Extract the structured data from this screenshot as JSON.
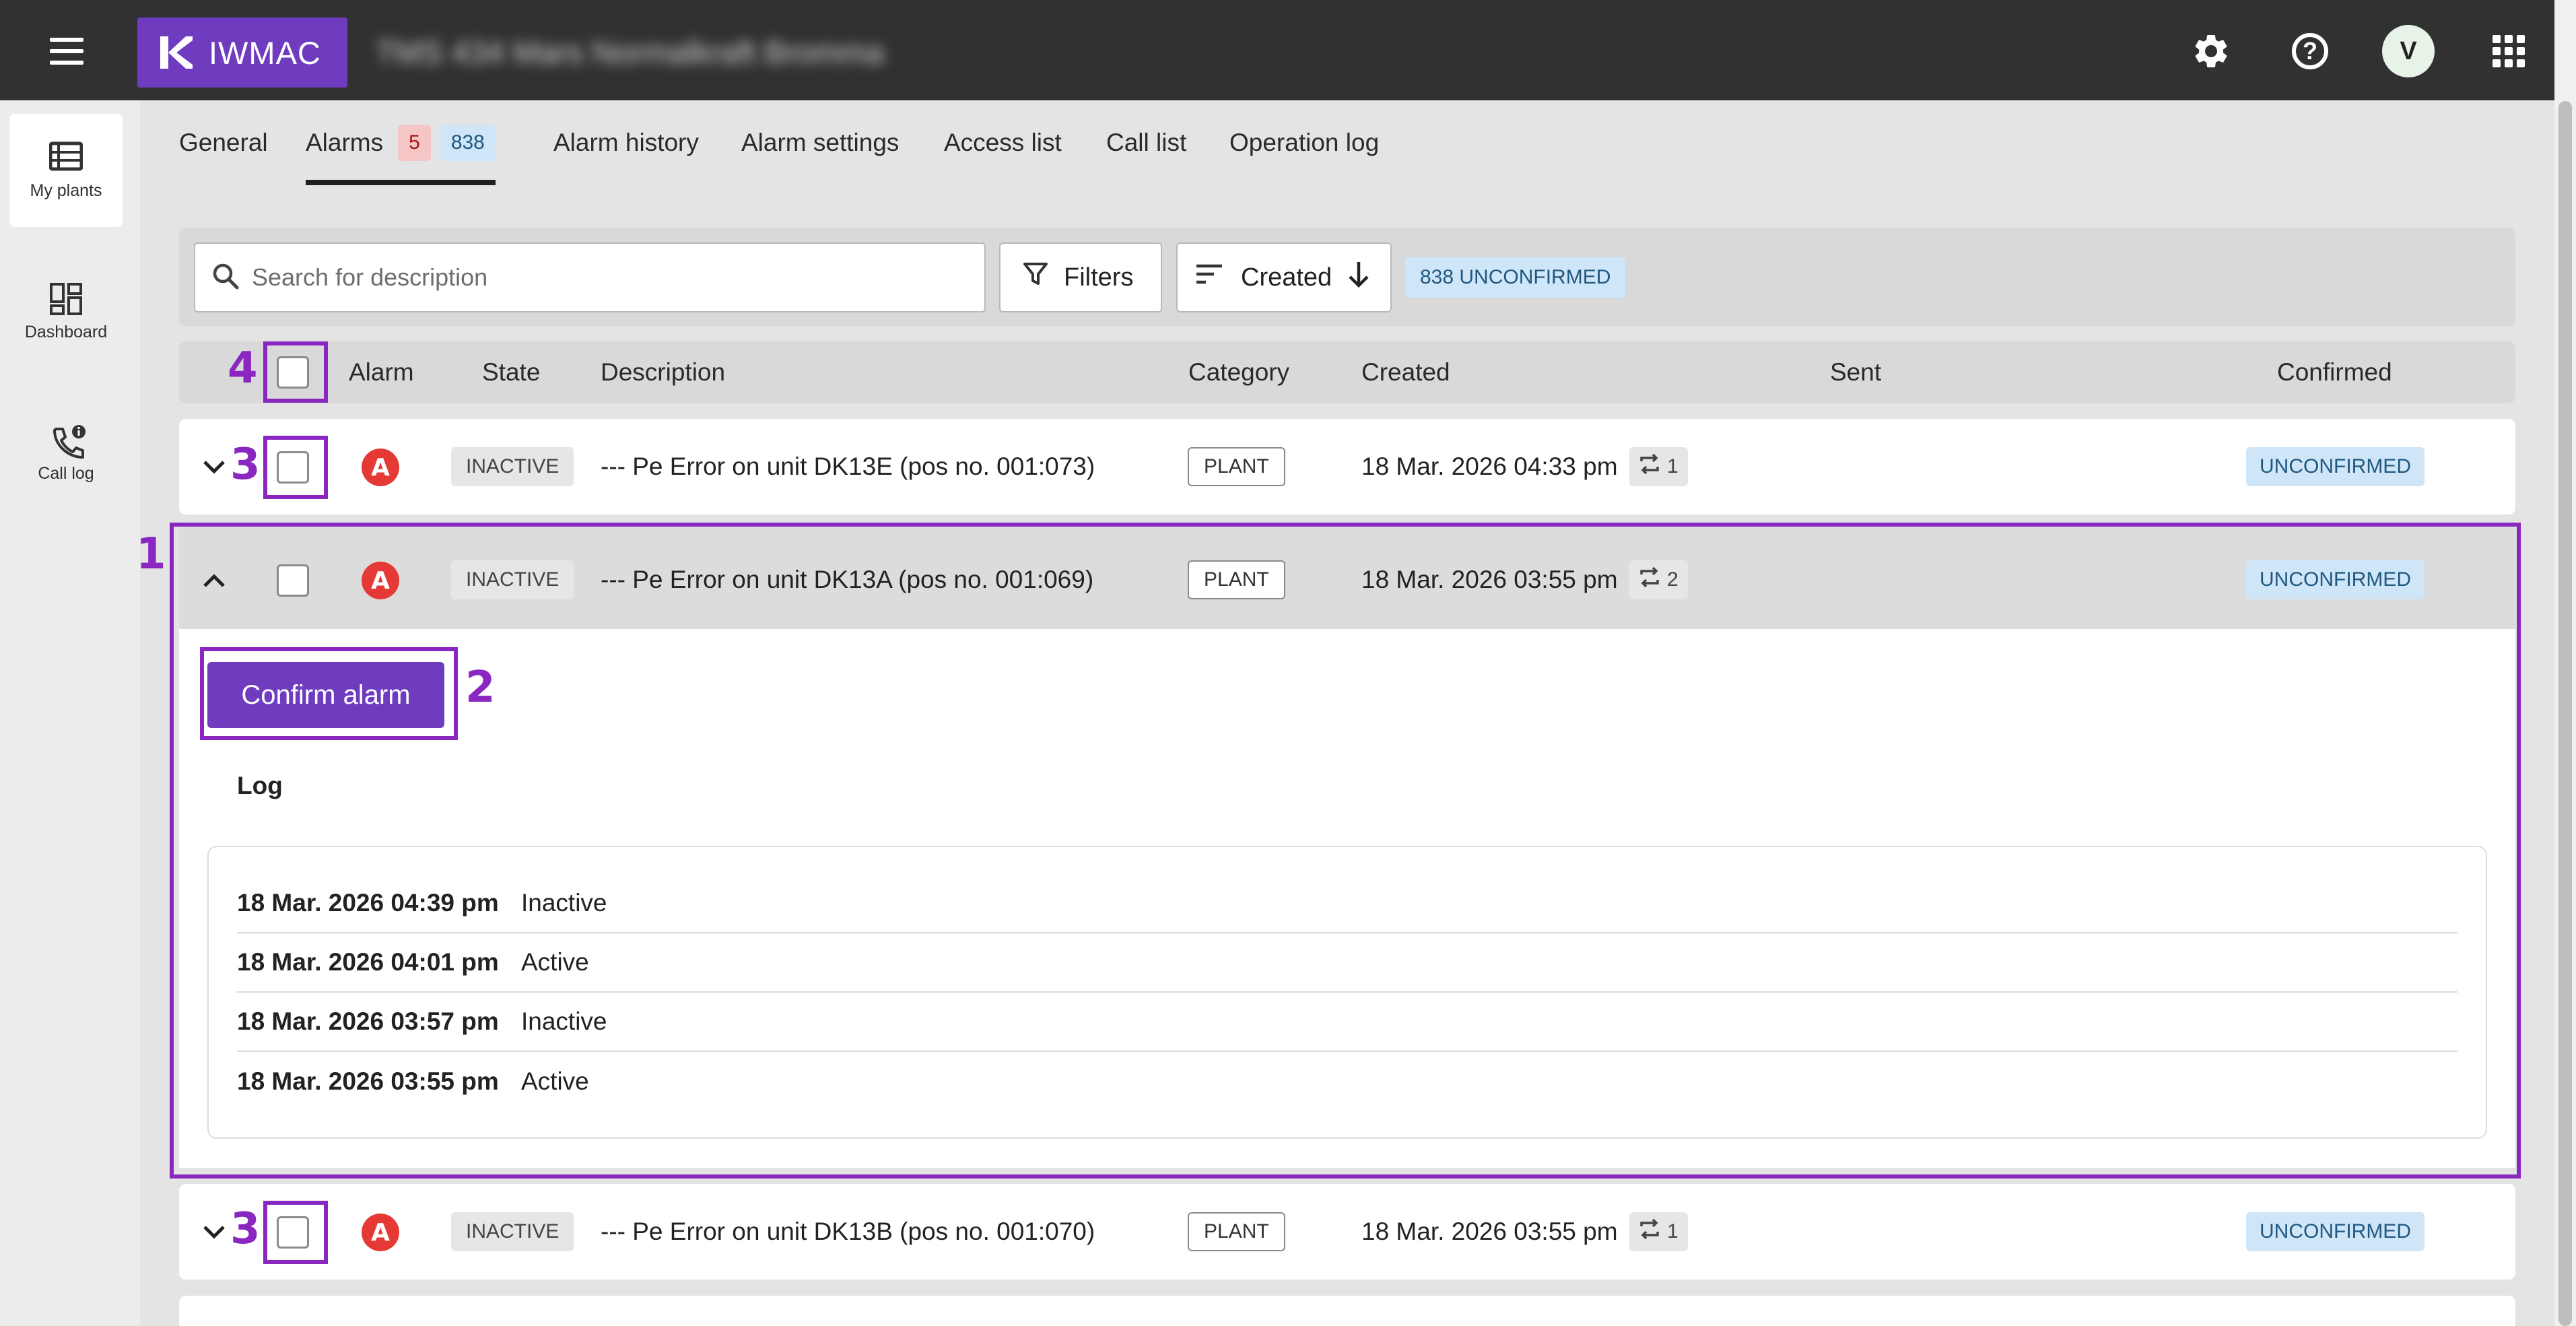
{
  "app": {
    "brand": "IWMAC",
    "plant_title": "TMS 434 Mars Normalkraft Bromma"
  },
  "topbar": {
    "icons": [
      "menu-icon",
      "settings-icon",
      "help-icon",
      "apps-grid-icon"
    ],
    "avatar_initial": "V"
  },
  "rail": {
    "items": [
      {
        "label": "My plants",
        "icon": "list-icon"
      },
      {
        "label": "Dashboard",
        "icon": "dashboard-icon"
      },
      {
        "label": "Call log",
        "icon": "phone-info-icon"
      }
    ]
  },
  "tabs": {
    "general": "General",
    "alarms": "Alarms",
    "alarms_active_count": "5",
    "alarms_unconfirmed_count": "838",
    "alarm_history": "Alarm history",
    "alarm_settings": "Alarm settings",
    "access_list": "Access list",
    "call_list": "Call list",
    "operation_log": "Operation log"
  },
  "toolbar": {
    "search_placeholder": "Search for description",
    "filters_label": "Filters",
    "sort_label": "Created",
    "unconfirmed_chip": "838 UNCONFIRMED"
  },
  "table": {
    "headers": {
      "alarm": "Alarm",
      "state": "State",
      "description": "Description",
      "category": "Category",
      "created": "Created",
      "sent": "Sent",
      "confirmed": "Confirmed"
    },
    "rows": [
      {
        "alarm": "A",
        "state": "INACTIVE",
        "description": "--- Pe Error on unit DK13E (pos no. 001:073)",
        "category": "PLANT",
        "created": "18 Mar. 2026 04:33 pm",
        "repeat": "1",
        "confirmed": "UNCONFIRMED"
      },
      {
        "alarm": "A",
        "state": "INACTIVE",
        "description": "--- Pe Error on unit DK13A (pos no. 001:069)",
        "category": "PLANT",
        "created": "18 Mar. 2026 03:55 pm",
        "repeat": "2",
        "confirmed": "UNCONFIRMED"
      },
      {
        "alarm": "A",
        "state": "INACTIVE",
        "description": "--- Pe Error on unit DK13B (pos no. 001:070)",
        "category": "PLANT",
        "created": "18 Mar. 2026 03:55 pm",
        "repeat": "1",
        "confirmed": "UNCONFIRMED"
      }
    ]
  },
  "expanded": {
    "confirm_label": "Confirm alarm",
    "log_title": "Log",
    "log": [
      {
        "date": "18 Mar. 2026 04:39 pm",
        "state": "Inactive"
      },
      {
        "date": "18 Mar. 2026 04:01 pm",
        "state": "Active"
      },
      {
        "date": "18 Mar. 2026 03:57 pm",
        "state": "Inactive"
      },
      {
        "date": "18 Mar. 2026 03:55 pm",
        "state": "Active"
      }
    ]
  },
  "annotations": {
    "n1": "1",
    "n2": "2",
    "n3": "3",
    "n4": "4"
  },
  "colors": {
    "brand": "#6f3cc0",
    "annotation": "#8a27c0",
    "alarm": "#e53935",
    "unconfirmed_bg": "#cfe6f8"
  }
}
